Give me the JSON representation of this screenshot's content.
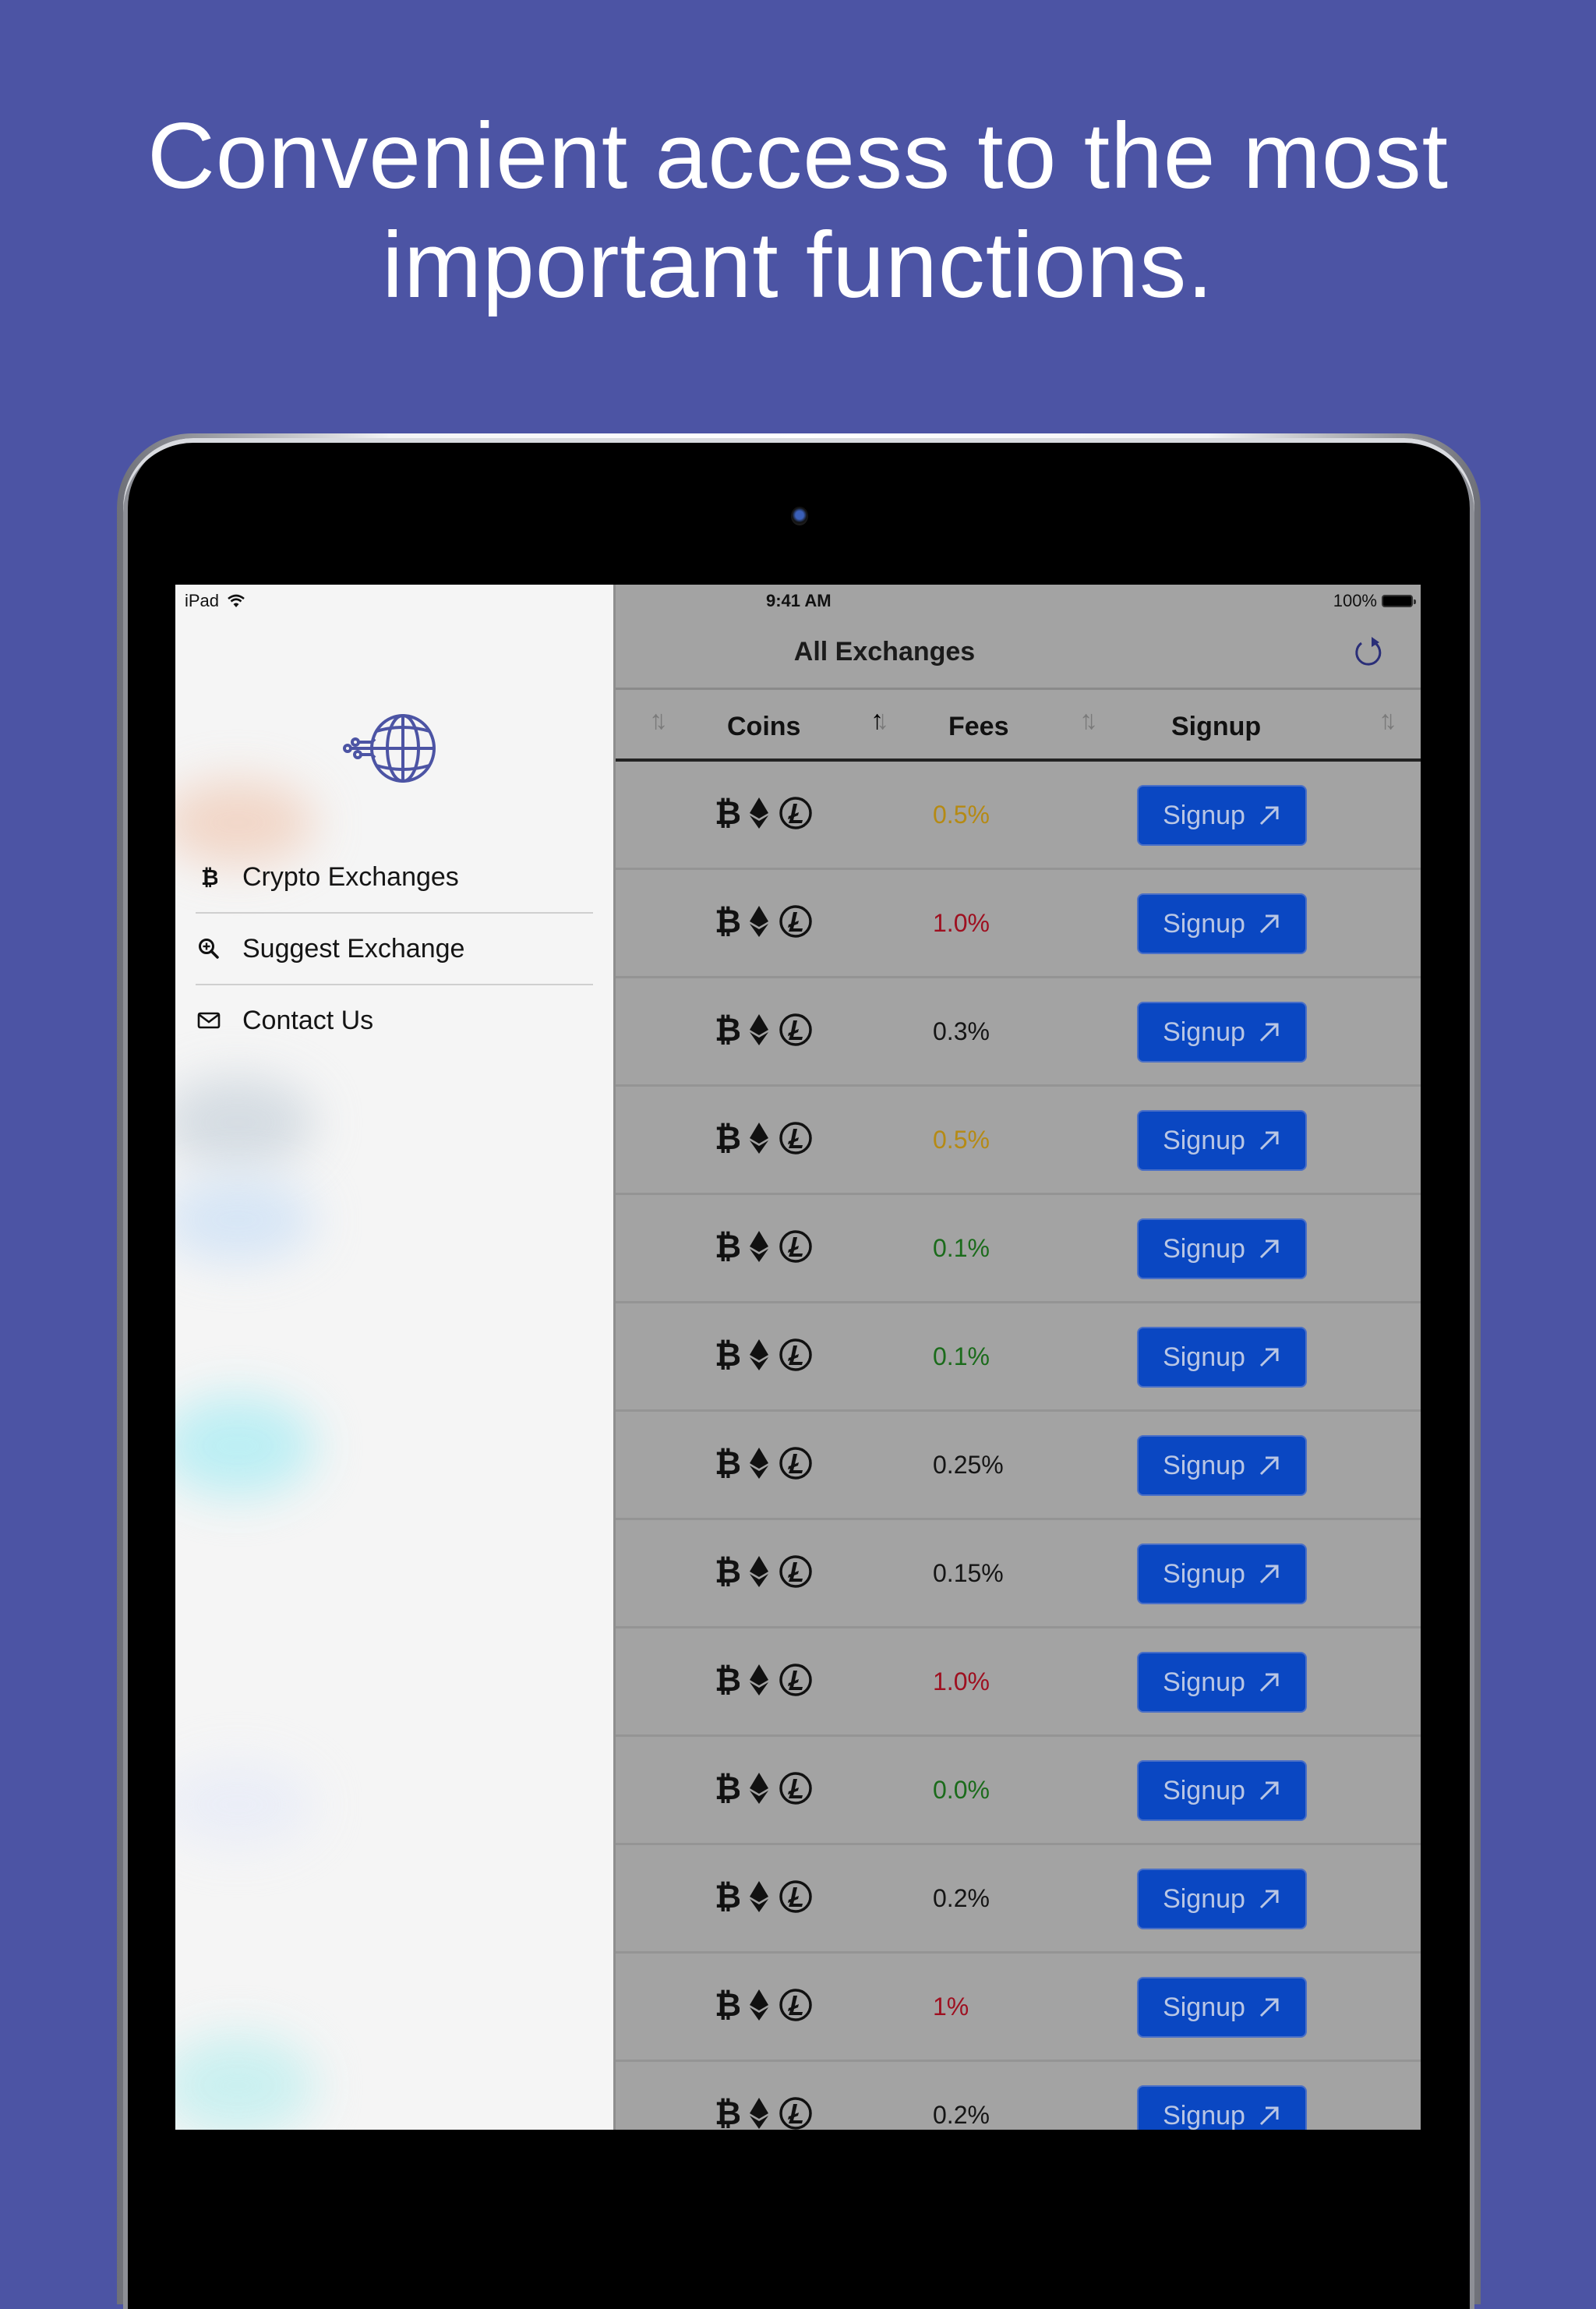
{
  "headline": {
    "line1": "Convenient access to the most",
    "line2": "important functions."
  },
  "status_bar": {
    "device": "iPad",
    "time": "9:41 AM",
    "battery": "100%"
  },
  "sidebar": {
    "logo_icon": "globe-network-icon",
    "items": [
      {
        "label": "Crypto Exchanges",
        "icon": "bitcoin-icon"
      },
      {
        "label": "Suggest Exchange",
        "icon": "zoom-plus-icon"
      },
      {
        "label": "Contact Us",
        "icon": "envelope-icon"
      }
    ]
  },
  "navbar": {
    "title": "All Exchanges",
    "refresh_icon": "refresh-icon"
  },
  "table": {
    "columns": [
      {
        "label": "",
        "sort": "none"
      },
      {
        "label": "Coins",
        "sort": "ascending"
      },
      {
        "label": "Fees",
        "sort": "none"
      },
      {
        "label": "Signup",
        "sort": "none"
      }
    ],
    "coin_icons": [
      "bitcoin-icon",
      "ethereum-icon",
      "litecoin-icon"
    ],
    "rows": [
      {
        "fee": "0.5%",
        "fee_color": "#b58a14",
        "signup": "Signup"
      },
      {
        "fee": "1.0%",
        "fee_color": "#9e1020",
        "signup": "Signup"
      },
      {
        "fee": "0.3%",
        "fee_color": "#151515",
        "signup": "Signup"
      },
      {
        "fee": "0.5%",
        "fee_color": "#b58a14",
        "signup": "Signup"
      },
      {
        "fee": "0.1%",
        "fee_color": "#1b6b1b",
        "signup": "Signup"
      },
      {
        "fee": "0.1%",
        "fee_color": "#1b6b1b",
        "signup": "Signup"
      },
      {
        "fee": "0.25%",
        "fee_color": "#151515",
        "signup": "Signup"
      },
      {
        "fee": "0.15%",
        "fee_color": "#151515",
        "signup": "Signup"
      },
      {
        "fee": "1.0%",
        "fee_color": "#9e1020",
        "signup": "Signup"
      },
      {
        "fee": "0.0%",
        "fee_color": "#1b6b1b",
        "signup": "Signup"
      },
      {
        "fee": "0.2%",
        "fee_color": "#151515",
        "signup": "Signup"
      },
      {
        "fee": "1%",
        "fee_color": "#9e1020",
        "signup": "Signup"
      },
      {
        "fee": "0.2%",
        "fee_color": "#151515",
        "signup": "Signup"
      }
    ]
  },
  "colors": {
    "background": "#4c54a4",
    "accent": "#4c54a4",
    "button": "#0a47c2",
    "overlay": "#a3a3a3"
  }
}
